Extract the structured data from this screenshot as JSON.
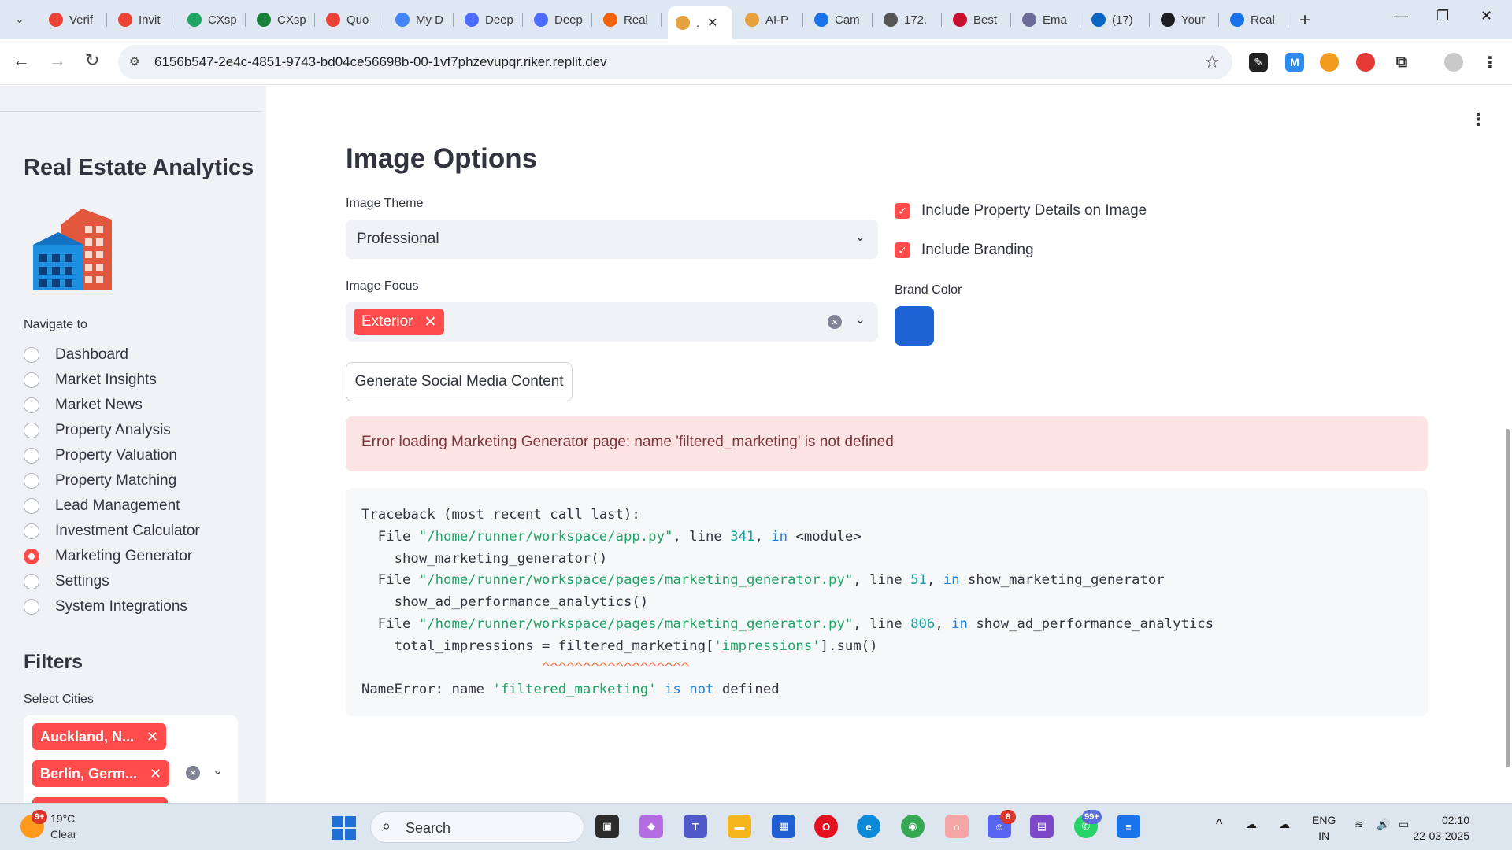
{
  "browser": {
    "tabs": [
      {
        "label": "Verif",
        "icon": "gmail-icon",
        "color": "#ea4335"
      },
      {
        "label": "Invit",
        "icon": "gmail-icon",
        "color": "#ea4335"
      },
      {
        "label": "CXsp",
        "icon": "drive-icon",
        "color": "#1fa463"
      },
      {
        "label": "CXsp",
        "icon": "sheets-icon",
        "color": "#188038"
      },
      {
        "label": "Quo",
        "icon": "gmail-icon",
        "color": "#ea4335"
      },
      {
        "label": "My D",
        "icon": "maps-icon",
        "color": "#4285f4"
      },
      {
        "label": "Deep",
        "icon": "deepseek-icon",
        "color": "#4d6bfe"
      },
      {
        "label": "Deep",
        "icon": "deepseek-icon",
        "color": "#4d6bfe"
      },
      {
        "label": "Real",
        "icon": "replit-icon",
        "color": "#f26207"
      },
      {
        "label": ".",
        "icon": "house-icon",
        "color": "#e6a23c"
      },
      {
        "label": "AI-P",
        "icon": "house-icon",
        "color": "#e6a23c"
      },
      {
        "label": "Cam",
        "icon": "camp-icon",
        "color": "#1a73e8"
      },
      {
        "label": "172.",
        "icon": "s-icon",
        "color": "#555555"
      },
      {
        "label": "Best",
        "icon": "ind-icon",
        "color": "#c8102e"
      },
      {
        "label": "Ema",
        "icon": "email-icon",
        "color": "#6b6b9a"
      },
      {
        "label": "(17)",
        "icon": "linkedin-icon",
        "color": "#0a66c2"
      },
      {
        "label": "Your",
        "icon": "github-icon",
        "color": "#1b1f23"
      },
      {
        "label": "Real",
        "icon": "search-icon",
        "color": "#1a73e8"
      }
    ],
    "url": "6156b547-2e4c-4851-9743-bd04ce56698b-00-1vf7phzevupqr.riker.replit.dev"
  },
  "sidebar": {
    "title": "Real Estate Analytics",
    "nav_label": "Navigate to",
    "nav_items": [
      {
        "label": "Dashboard",
        "selected": false
      },
      {
        "label": "Market Insights",
        "selected": false
      },
      {
        "label": "Market News",
        "selected": false
      },
      {
        "label": "Property Analysis",
        "selected": false
      },
      {
        "label": "Property Valuation",
        "selected": false
      },
      {
        "label": "Property Matching",
        "selected": false
      },
      {
        "label": "Lead Management",
        "selected": false
      },
      {
        "label": "Investment Calculator",
        "selected": false
      },
      {
        "label": "Marketing Generator",
        "selected": true
      },
      {
        "label": "Settings",
        "selected": false
      },
      {
        "label": "System Integrations",
        "selected": false
      }
    ],
    "filters_title": "Filters",
    "cities_label": "Select Cities",
    "cities": [
      "Auckland, N...",
      "Berlin, Germ..."
    ]
  },
  "main": {
    "heading": "Image Options",
    "theme_label": "Image Theme",
    "theme_value": "Professional",
    "focus_label": "Image Focus",
    "focus_tag": "Exterior",
    "include_details": "Include Property Details on Image",
    "include_branding": "Include Branding",
    "brand_color_label": "Brand Color",
    "brand_color": "#1e63d6",
    "generate_button": "Generate Social Media Content",
    "error_message": "Error loading Marketing Generator page: name 'filtered_marketing' is not defined",
    "traceback": {
      "header": "Traceback (most recent call last):",
      "frames": [
        {
          "file": "\"/home/runner/workspace/app.py\"",
          "line": "341",
          "func": "<module>",
          "code": "show_marketing_generator()"
        },
        {
          "file": "\"/home/runner/workspace/pages/marketing_generator.py\"",
          "line": "51",
          "func": "show_marketing_generator",
          "code": "show_ad_performance_analytics()"
        },
        {
          "file": "\"/home/runner/workspace/pages/marketing_generator.py\"",
          "line": "806",
          "func": "show_ad_performance_analytics",
          "code_pre": "total_impressions = filtered_marketing[",
          "code_str": "'impressions'",
          "code_post": "].sum()"
        }
      ],
      "carets": "^^^^^^^^^^^^^^^^^^",
      "error_type": "NameError: name ",
      "error_name": "'filtered_marketing'",
      "error_is": "is",
      "error_not": "not",
      "error_tail": "defined"
    }
  },
  "taskbar": {
    "weather_badge": "9+",
    "temperature": "19°C",
    "condition": "Clear",
    "search_placeholder": "Search",
    "discord_badge": "8",
    "whatsapp_badge": "99+",
    "language_top": "ENG",
    "language_bottom": "IN",
    "time": "02:10",
    "date": "22-03-2025"
  }
}
